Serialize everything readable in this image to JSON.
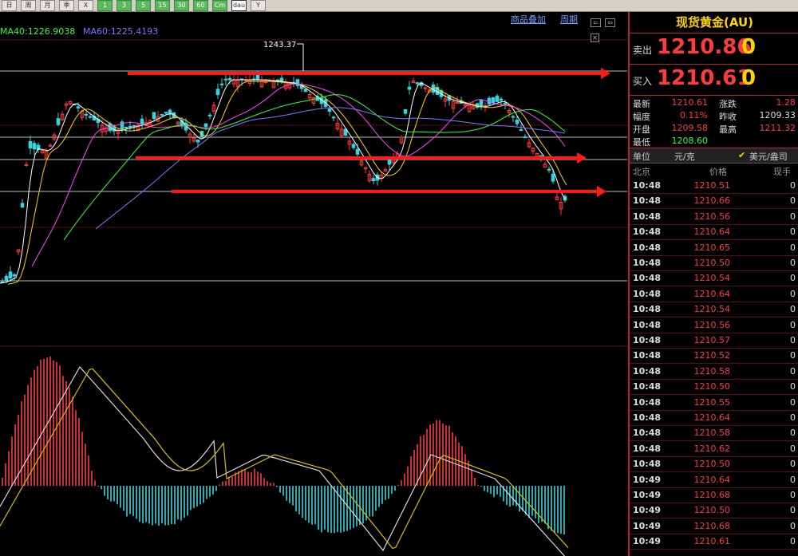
{
  "toolbar": {
    "buttons": [
      "日",
      "周",
      "月",
      "季",
      "X",
      "1",
      "3",
      "5",
      "15",
      "30",
      "60",
      "Cm",
      "dau",
      "Y"
    ]
  },
  "chart": {
    "ma40_label": "MA40:1226.9038",
    "ma60_label": "MA60:1225.4193",
    "high_label": "1243.37",
    "overlay_link": "商品叠加",
    "period_link": "周期"
  },
  "panel": {
    "title": "现货黄金(AU)",
    "sell_label": "卖出",
    "sell_price": "1210.86",
    "sell_vol": "0",
    "buy_label": "买入",
    "buy_price": "1210.61",
    "buy_vol": "0",
    "stats": {
      "latest_label": "最新",
      "latest": "1210.61",
      "change_label": "涨跌",
      "change": "1.28",
      "amp_label": "幅度",
      "amp": "0.11%",
      "prev_label": "昨收",
      "prev": "1209.33",
      "open_label": "开盘",
      "open": "1209.58",
      "high_label": "最高",
      "high": "1211.32",
      "low_label": "最低",
      "low": "1208.60"
    },
    "unit_label": "单位",
    "unit_value": "元/克",
    "unit_option": "美元/盎司",
    "columns": {
      "time": "北京",
      "price": "价格",
      "qty": "现手"
    },
    "ticks": [
      {
        "time": "10:48",
        "price": "1210.51",
        "qty": "0"
      },
      {
        "time": "10:48",
        "price": "1210.66",
        "qty": "0"
      },
      {
        "time": "10:48",
        "price": "1210.56",
        "qty": "0"
      },
      {
        "time": "10:48",
        "price": "1210.64",
        "qty": "0"
      },
      {
        "time": "10:48",
        "price": "1210.65",
        "qty": "0"
      },
      {
        "time": "10:48",
        "price": "1210.50",
        "qty": "0"
      },
      {
        "time": "10:48",
        "price": "1210.54",
        "qty": "0"
      },
      {
        "time": "10:48",
        "price": "1210.64",
        "qty": "0"
      },
      {
        "time": "10:48",
        "price": "1210.54",
        "qty": "0"
      },
      {
        "time": "10:48",
        "price": "1210.56",
        "qty": "0"
      },
      {
        "time": "10:48",
        "price": "1210.57",
        "qty": "0"
      },
      {
        "time": "10:48",
        "price": "1210.52",
        "qty": "0"
      },
      {
        "time": "10:48",
        "price": "1210.58",
        "qty": "0"
      },
      {
        "time": "10:48",
        "price": "1210.50",
        "qty": "0"
      },
      {
        "time": "10:48",
        "price": "1210.55",
        "qty": "0"
      },
      {
        "time": "10:48",
        "price": "1210.64",
        "qty": "0"
      },
      {
        "time": "10:48",
        "price": "1210.58",
        "qty": "0"
      },
      {
        "time": "10:48",
        "price": "1210.62",
        "qty": "0"
      },
      {
        "time": "10:48",
        "price": "1210.50",
        "qty": "0"
      },
      {
        "time": "10:49",
        "price": "1210.64",
        "qty": "0"
      },
      {
        "time": "10:49",
        "price": "1210.68",
        "qty": "0"
      },
      {
        "time": "10:49",
        "price": "1210.50",
        "qty": "0"
      },
      {
        "time": "10:49",
        "price": "1210.68",
        "qty": "0"
      },
      {
        "time": "10:49",
        "price": "1210.61",
        "qty": "0"
      }
    ]
  },
  "colors": {
    "up": "#ff3b3b",
    "down": "#33d6e0",
    "ma5": "#ffffff",
    "ma10": "#ffd400",
    "ma20": "#ff44ff",
    "ma40": "#33ff33",
    "ma60": "#7a7aff",
    "arrow": "#ff1a1a"
  }
}
